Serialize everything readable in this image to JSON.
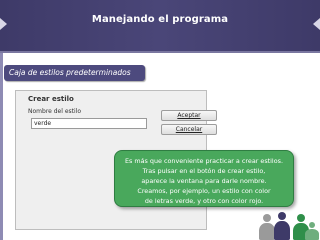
{
  "slide": {
    "title": "Manejando el programa",
    "section_label": "Caja de estilos predeterminados"
  },
  "dialog": {
    "title": "Crear estilo",
    "field_label": "Nombre del estilo",
    "field_value": "verde",
    "ok_button": "Aceptar",
    "cancel_button": "Cancelar"
  },
  "note": {
    "lines": [
      "Es más que conveniente practicar a crear estilos.",
      "Tras pulsar en el botón de crear estilo,",
      "aparece la ventana para darle nombre.",
      "Creamos, por ejemplo, un estilo con color",
      "de letras verde, y otro con color rojo."
    ]
  },
  "colors": {
    "header": "#3e3a68",
    "pill": "#4d4a7e",
    "note": "#49a85c",
    "person_green": "#2f8f4a",
    "person_blue": "#3e3a68",
    "person_gray": "#9a9a9a"
  }
}
